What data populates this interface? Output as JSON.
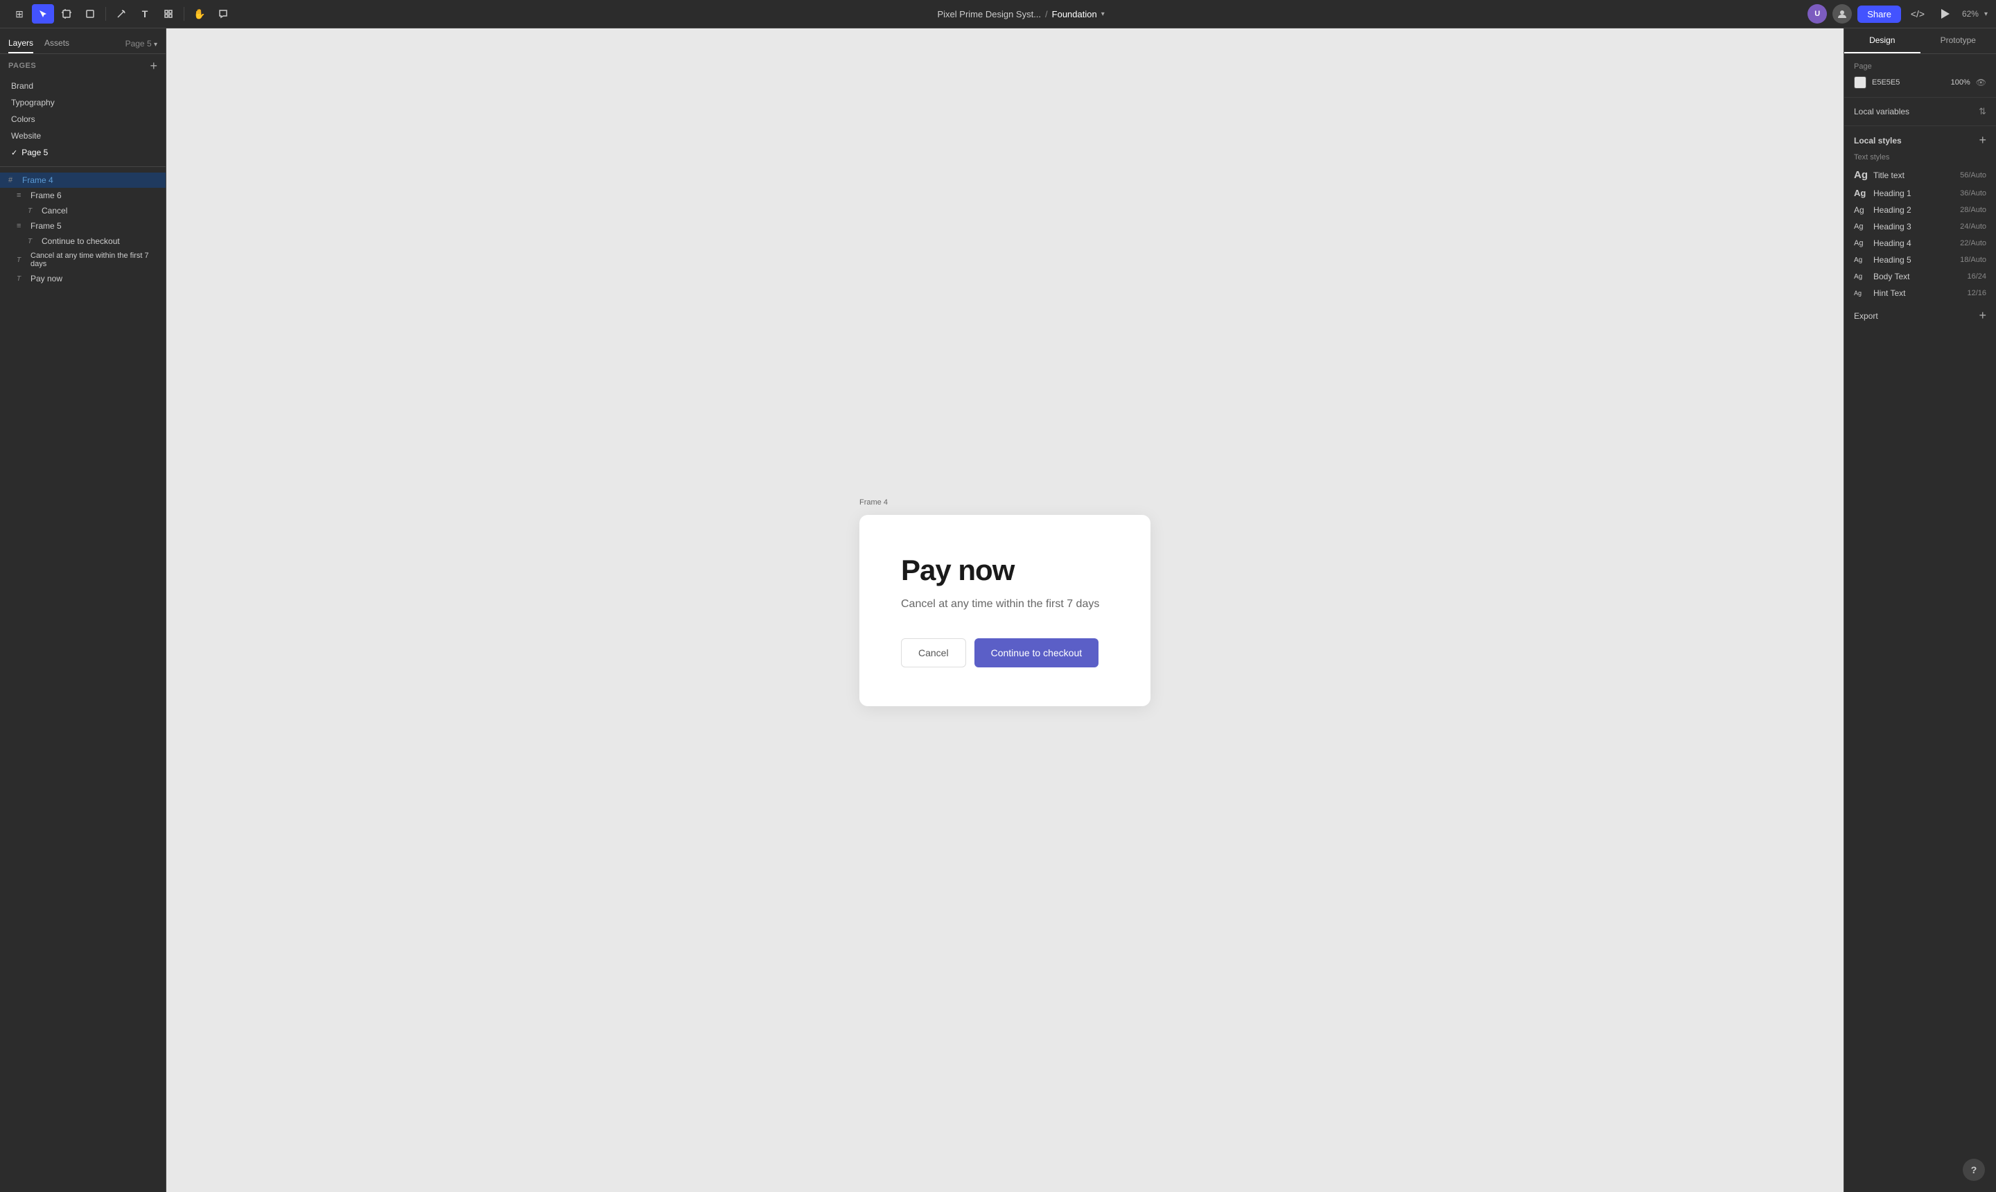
{
  "topbar": {
    "project_name": "Pixel Prime Design Syst...",
    "separator": "/",
    "page_name": "Foundation",
    "zoom_level": "62%",
    "share_label": "Share",
    "tools": [
      {
        "name": "main-menu",
        "icon": "⊞",
        "active": false
      },
      {
        "name": "move-tool",
        "icon": "↖",
        "active": true
      },
      {
        "name": "frame-tool",
        "icon": "#",
        "active": false
      },
      {
        "name": "shape-tool",
        "icon": "□",
        "active": false
      },
      {
        "name": "pen-tool",
        "icon": "✒",
        "active": false
      },
      {
        "name": "text-tool",
        "icon": "T",
        "active": false
      },
      {
        "name": "component-tool",
        "icon": "⊡",
        "active": false
      },
      {
        "name": "hand-tool",
        "icon": "✋",
        "active": false
      },
      {
        "name": "comment-tool",
        "icon": "💬",
        "active": false
      }
    ]
  },
  "left_sidebar": {
    "tabs": [
      {
        "label": "Layers",
        "active": true
      },
      {
        "label": "Assets",
        "active": false
      }
    ],
    "page_section": {
      "label": "Pages",
      "add_tooltip": "Add page"
    },
    "pages": [
      {
        "label": "Brand",
        "active": false
      },
      {
        "label": "Typography",
        "active": false
      },
      {
        "label": "Colors",
        "active": false
      },
      {
        "label": "Website",
        "active": false
      },
      {
        "label": "Page 5",
        "active": true
      }
    ],
    "current_page": "Page 5",
    "layers": [
      {
        "label": "Frame 4",
        "icon": "#",
        "indent": 0,
        "selected": true
      },
      {
        "label": "Frame 6",
        "icon": "≡≡",
        "indent": 1,
        "selected": false
      },
      {
        "label": "Cancel",
        "icon": "T",
        "indent": 2,
        "selected": false
      },
      {
        "label": "Frame 5",
        "icon": "≡≡",
        "indent": 1,
        "selected": false
      },
      {
        "label": "Continue to checkout",
        "icon": "T",
        "indent": 2,
        "selected": false
      },
      {
        "label": "Cancel at any time within the first 7 days",
        "icon": "T",
        "indent": 1,
        "selected": false
      },
      {
        "label": "Pay now",
        "icon": "T",
        "indent": 1,
        "selected": false
      }
    ]
  },
  "canvas": {
    "frame_label": "Frame 4",
    "background_color": "#e8e8e8",
    "card": {
      "title": "Pay now",
      "subtitle": "Cancel at any time within the first 7 days",
      "cancel_label": "Cancel",
      "checkout_label": "Continue to checkout"
    }
  },
  "right_sidebar": {
    "tabs": [
      {
        "label": "Design",
        "active": true
      },
      {
        "label": "Prototype",
        "active": false
      }
    ],
    "page_section": {
      "label": "Page",
      "color_value": "E5E5E5",
      "opacity": "100%"
    },
    "local_variables": {
      "label": "Local variables"
    },
    "local_styles": {
      "label": "Local styles"
    },
    "text_styles": {
      "label": "Text styles",
      "items": [
        {
          "ag": "Ag",
          "name": "Title text",
          "size": "56/Auto",
          "ag_class": "ag-title"
        },
        {
          "ag": "Ag",
          "name": "Heading 1",
          "size": "36/Auto",
          "ag_class": "ag-h1"
        },
        {
          "ag": "Ag",
          "name": "Heading 2",
          "size": "28/Auto",
          "ag_class": "ag-h2"
        },
        {
          "ag": "Ag",
          "name": "Heading 3",
          "size": "24/Auto",
          "ag_class": "ag-h3"
        },
        {
          "ag": "Ag",
          "name": "Heading 4",
          "size": "22/Auto",
          "ag_class": "ag-h4"
        },
        {
          "ag": "Ag",
          "name": "Heading 5",
          "size": "18/Auto",
          "ag_class": "ag-h5"
        },
        {
          "ag": "Ag",
          "name": "Body Text",
          "size": "16/24",
          "ag_class": "ag-body"
        },
        {
          "ag": "Ag",
          "name": "Hint Text",
          "size": "12/16",
          "ag_class": "ag-hint"
        }
      ]
    },
    "export": {
      "label": "Export"
    }
  }
}
